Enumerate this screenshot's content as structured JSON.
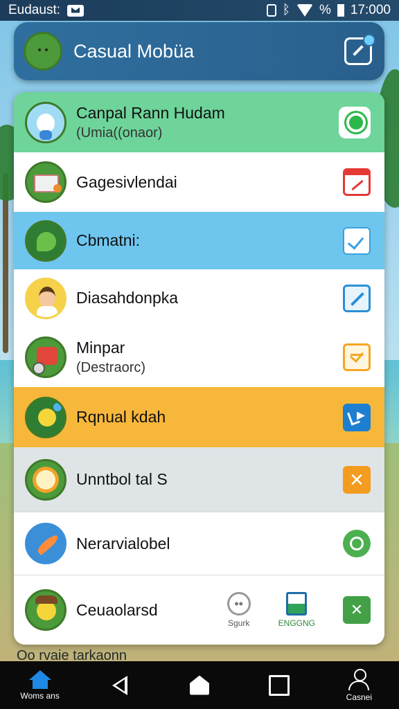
{
  "status_bar": {
    "left_text": "Eudaust:",
    "time": "17:000",
    "percent_sign": "%",
    "icons": [
      "message-icon",
      "vibrate-icon",
      "bluetooth-icon",
      "wifi-icon",
      "battery-icon"
    ]
  },
  "header": {
    "title": "Casual Mobüa",
    "avatar_icon": "boy-avatar-icon",
    "action_icon": "edit-icon"
  },
  "rows": [
    {
      "title": "Canpal Rann Hudam",
      "subtitle": "(Umia((onaor)",
      "avatar_icon": "white-cat-avatar-icon",
      "action_icon": "search-icon",
      "bg": "#6ed49a",
      "action_color": "#2db84b"
    },
    {
      "title": "Gagesivlendai",
      "avatar_icon": "toolbox-avatar-icon",
      "action_icon": "calendar-icon",
      "bg": "#ffffff",
      "action_color": "#e53935"
    },
    {
      "title": "Cbmatni:",
      "avatar_icon": "bird-avatar-icon",
      "action_icon": "check-icon",
      "bg": "#6ec6ee",
      "action_color": "#3aa0de"
    },
    {
      "title": "Diasahdonpka",
      "avatar_icon": "kid-avatar-icon",
      "action_icon": "pen-icon",
      "bg": "#ffffff",
      "action_color": "#2a8fd8"
    },
    {
      "title": "Minpar",
      "subtitle": "(Destraorc)",
      "avatar_icon": "backpack-avatar-icon",
      "action_icon": "check-icon",
      "bg": "#ffffff",
      "action_color": "#f5a623"
    },
    {
      "title": "Rqnual kdah",
      "avatar_icon": "chick-avatar-icon",
      "action_icon": "share-icon",
      "bg": "#f7b73a",
      "action_color": "#1e7fd1"
    },
    {
      "title": "Unntbol tal S",
      "avatar_icon": "sun-avatar-icon",
      "action_icon": "close-icon",
      "bg": "#dfe4e6",
      "action_color": "#f39c1f"
    },
    {
      "title": "Nerarvialobel",
      "avatar_icon": "feather-avatar-icon",
      "action_icon": "settings-icon",
      "bg": "#ffffff",
      "action_color": "#4caf50"
    },
    {
      "title": "Ceuaolarsd",
      "avatar_icon": "duck-avatar-icon",
      "action_icon": "close-icon",
      "bg": "#ffffff",
      "action_color": "#43a047",
      "extras": [
        {
          "label": "Sgurk",
          "icon": "smiley-icon"
        },
        {
          "label": "ENGGNG",
          "icon": "clipboard-icon"
        }
      ]
    }
  ],
  "bottom_hint": "Oo rvaie tarkaonn",
  "nav": {
    "home_label": "Woms ans",
    "profile_label": "Casnei"
  }
}
